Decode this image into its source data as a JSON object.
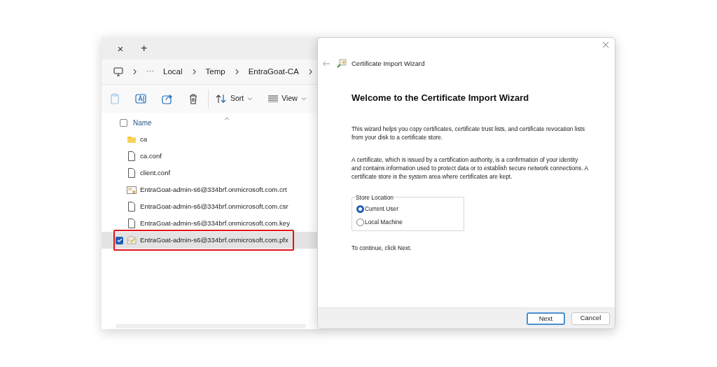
{
  "explorer": {
    "tab_close": "×",
    "new_tab": "+",
    "more": "⋯",
    "breadcrumb": [
      "Local",
      "Temp",
      "EntraGoat-CA"
    ],
    "toolbar": {
      "sort": "Sort",
      "view": "View"
    },
    "column": {
      "label": "Name",
      "checked": false
    },
    "files": [
      {
        "kind": "folder",
        "name": "ca",
        "selected": false
      },
      {
        "kind": "file",
        "name": "ca.conf",
        "selected": false
      },
      {
        "kind": "file",
        "name": "client.conf",
        "selected": false
      },
      {
        "kind": "certificate",
        "name": "EntraGoat-admin-s6@334brf.onmicrosoft.com.crt",
        "selected": false
      },
      {
        "kind": "file",
        "name": "EntraGoat-admin-s6@334brf.onmicrosoft.com.csr",
        "selected": false
      },
      {
        "kind": "file",
        "name": "EntraGoat-admin-s6@334brf.onmicrosoft.com.key",
        "selected": false
      },
      {
        "kind": "pfx",
        "name": "EntraGoat-admin-s6@334brf.onmicrosoft.com.pfx",
        "selected": true
      }
    ]
  },
  "wizard": {
    "title": "Certificate Import Wizard",
    "heading": "Welcome to the Certificate Import Wizard",
    "paragraphs": [
      "This wizard helps you copy certificates, certificate trust lists, and certificate revocation lists from your disk to a certificate store.",
      "A certificate, which is issued by a certification authority, is a confirmation of your identity and contains information used to protect data or to establish secure network connections. A certificate store is the system area where certificates are kept."
    ],
    "store_location": {
      "label": "Store Location",
      "options": [
        {
          "label": "Current User",
          "selected": true
        },
        {
          "label": "Local Machine",
          "selected": false
        }
      ]
    },
    "instruction": "To continue, click Next.",
    "buttons": [
      {
        "label": "Next",
        "default": true
      },
      {
        "label": "Cancel",
        "default": false
      }
    ]
  }
}
